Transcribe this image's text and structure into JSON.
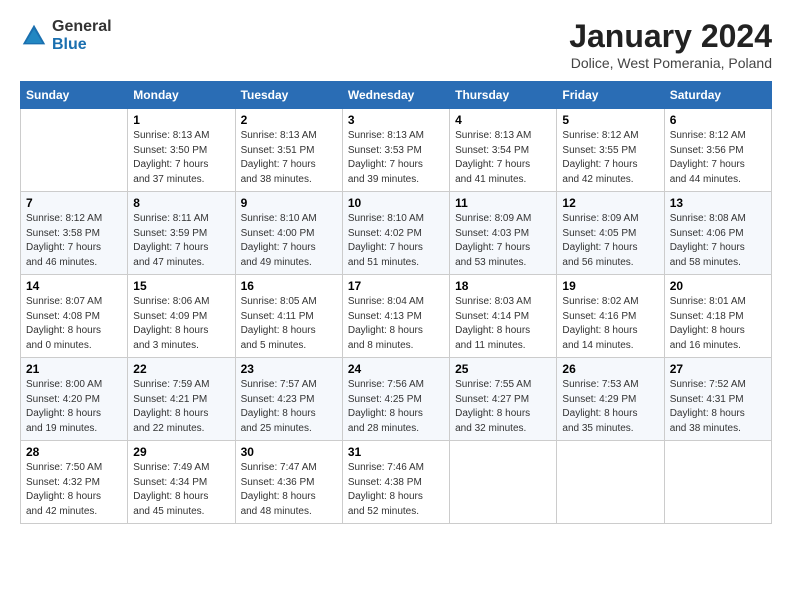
{
  "logo": {
    "general": "General",
    "blue": "Blue"
  },
  "header": {
    "title": "January 2024",
    "subtitle": "Dolice, West Pomerania, Poland"
  },
  "columns": [
    "Sunday",
    "Monday",
    "Tuesday",
    "Wednesday",
    "Thursday",
    "Friday",
    "Saturday"
  ],
  "weeks": [
    [
      {
        "num": "",
        "info": ""
      },
      {
        "num": "1",
        "info": "Sunrise: 8:13 AM\nSunset: 3:50 PM\nDaylight: 7 hours\nand 37 minutes."
      },
      {
        "num": "2",
        "info": "Sunrise: 8:13 AM\nSunset: 3:51 PM\nDaylight: 7 hours\nand 38 minutes."
      },
      {
        "num": "3",
        "info": "Sunrise: 8:13 AM\nSunset: 3:53 PM\nDaylight: 7 hours\nand 39 minutes."
      },
      {
        "num": "4",
        "info": "Sunrise: 8:13 AM\nSunset: 3:54 PM\nDaylight: 7 hours\nand 41 minutes."
      },
      {
        "num": "5",
        "info": "Sunrise: 8:12 AM\nSunset: 3:55 PM\nDaylight: 7 hours\nand 42 minutes."
      },
      {
        "num": "6",
        "info": "Sunrise: 8:12 AM\nSunset: 3:56 PM\nDaylight: 7 hours\nand 44 minutes."
      }
    ],
    [
      {
        "num": "7",
        "info": "Sunrise: 8:12 AM\nSunset: 3:58 PM\nDaylight: 7 hours\nand 46 minutes."
      },
      {
        "num": "8",
        "info": "Sunrise: 8:11 AM\nSunset: 3:59 PM\nDaylight: 7 hours\nand 47 minutes."
      },
      {
        "num": "9",
        "info": "Sunrise: 8:10 AM\nSunset: 4:00 PM\nDaylight: 7 hours\nand 49 minutes."
      },
      {
        "num": "10",
        "info": "Sunrise: 8:10 AM\nSunset: 4:02 PM\nDaylight: 7 hours\nand 51 minutes."
      },
      {
        "num": "11",
        "info": "Sunrise: 8:09 AM\nSunset: 4:03 PM\nDaylight: 7 hours\nand 53 minutes."
      },
      {
        "num": "12",
        "info": "Sunrise: 8:09 AM\nSunset: 4:05 PM\nDaylight: 7 hours\nand 56 minutes."
      },
      {
        "num": "13",
        "info": "Sunrise: 8:08 AM\nSunset: 4:06 PM\nDaylight: 7 hours\nand 58 minutes."
      }
    ],
    [
      {
        "num": "14",
        "info": "Sunrise: 8:07 AM\nSunset: 4:08 PM\nDaylight: 8 hours\nand 0 minutes."
      },
      {
        "num": "15",
        "info": "Sunrise: 8:06 AM\nSunset: 4:09 PM\nDaylight: 8 hours\nand 3 minutes."
      },
      {
        "num": "16",
        "info": "Sunrise: 8:05 AM\nSunset: 4:11 PM\nDaylight: 8 hours\nand 5 minutes."
      },
      {
        "num": "17",
        "info": "Sunrise: 8:04 AM\nSunset: 4:13 PM\nDaylight: 8 hours\nand 8 minutes."
      },
      {
        "num": "18",
        "info": "Sunrise: 8:03 AM\nSunset: 4:14 PM\nDaylight: 8 hours\nand 11 minutes."
      },
      {
        "num": "19",
        "info": "Sunrise: 8:02 AM\nSunset: 4:16 PM\nDaylight: 8 hours\nand 14 minutes."
      },
      {
        "num": "20",
        "info": "Sunrise: 8:01 AM\nSunset: 4:18 PM\nDaylight: 8 hours\nand 16 minutes."
      }
    ],
    [
      {
        "num": "21",
        "info": "Sunrise: 8:00 AM\nSunset: 4:20 PM\nDaylight: 8 hours\nand 19 minutes."
      },
      {
        "num": "22",
        "info": "Sunrise: 7:59 AM\nSunset: 4:21 PM\nDaylight: 8 hours\nand 22 minutes."
      },
      {
        "num": "23",
        "info": "Sunrise: 7:57 AM\nSunset: 4:23 PM\nDaylight: 8 hours\nand 25 minutes."
      },
      {
        "num": "24",
        "info": "Sunrise: 7:56 AM\nSunset: 4:25 PM\nDaylight: 8 hours\nand 28 minutes."
      },
      {
        "num": "25",
        "info": "Sunrise: 7:55 AM\nSunset: 4:27 PM\nDaylight: 8 hours\nand 32 minutes."
      },
      {
        "num": "26",
        "info": "Sunrise: 7:53 AM\nSunset: 4:29 PM\nDaylight: 8 hours\nand 35 minutes."
      },
      {
        "num": "27",
        "info": "Sunrise: 7:52 AM\nSunset: 4:31 PM\nDaylight: 8 hours\nand 38 minutes."
      }
    ],
    [
      {
        "num": "28",
        "info": "Sunrise: 7:50 AM\nSunset: 4:32 PM\nDaylight: 8 hours\nand 42 minutes."
      },
      {
        "num": "29",
        "info": "Sunrise: 7:49 AM\nSunset: 4:34 PM\nDaylight: 8 hours\nand 45 minutes."
      },
      {
        "num": "30",
        "info": "Sunrise: 7:47 AM\nSunset: 4:36 PM\nDaylight: 8 hours\nand 48 minutes."
      },
      {
        "num": "31",
        "info": "Sunrise: 7:46 AM\nSunset: 4:38 PM\nDaylight: 8 hours\nand 52 minutes."
      },
      {
        "num": "",
        "info": ""
      },
      {
        "num": "",
        "info": ""
      },
      {
        "num": "",
        "info": ""
      }
    ]
  ]
}
